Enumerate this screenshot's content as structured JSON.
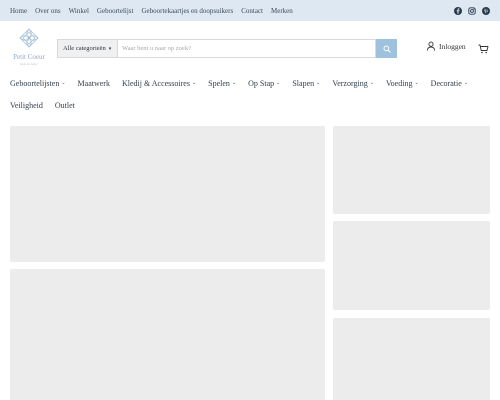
{
  "topbar": {
    "links": [
      "Home",
      "Over ons",
      "Winkel",
      "Geboortelijst",
      "Geboortekaartjes en doopsuikers",
      "Contact",
      "Merken"
    ],
    "social": [
      "facebook-icon",
      "instagram-icon",
      "pinterest-icon"
    ]
  },
  "logo": {
    "name": "Petit Coeur",
    "tagline": "kids & baby"
  },
  "search": {
    "category": "Alle categorieën",
    "placeholder": "Waar bent u naar op zoek?"
  },
  "account": {
    "login_label": "Inloggen"
  },
  "nav": {
    "row1": [
      {
        "label": "Geboortelijsten",
        "dropdown": true
      },
      {
        "label": "Maatwerk",
        "dropdown": false
      },
      {
        "label": "Kledij & Accessoires",
        "dropdown": true
      },
      {
        "label": "Spelen",
        "dropdown": true
      },
      {
        "label": "Op Stap",
        "dropdown": true
      },
      {
        "label": "Slapen",
        "dropdown": true
      },
      {
        "label": "Verzorging",
        "dropdown": true
      },
      {
        "label": "Voeding",
        "dropdown": true
      },
      {
        "label": "Decoratie",
        "dropdown": true
      }
    ],
    "row2": [
      {
        "label": "Veiligheid",
        "dropdown": false
      },
      {
        "label": "Outlet",
        "dropdown": false
      }
    ]
  },
  "colors": {
    "topbar_bg": "#dde8f2",
    "accent": "#9ec2dd",
    "placeholder_block": "#ececec"
  }
}
